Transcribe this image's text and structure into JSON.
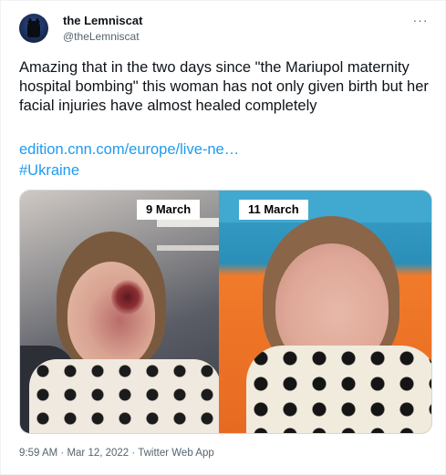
{
  "author": {
    "display_name": "the Lemniscat",
    "handle": "@theLemniscat"
  },
  "more_menu": "···",
  "tweet": {
    "text": "Amazing that in the two days since \"the Mariupol maternity hospital bombing\" this woman has not only given birth but her facial injuries have almost healed completely",
    "link": "edition.cnn.com/europe/live-ne…",
    "hashtag": "#Ukraine"
  },
  "media": {
    "left_label": "9 March",
    "right_label": "11 March"
  },
  "meta": {
    "time": "9:59 AM",
    "separator1": " · ",
    "date": "Mar 12, 2022",
    "separator2": " · ",
    "source": "Twitter Web App"
  },
  "colors": {
    "link": "#1d9bf0",
    "secondary_text": "#536471",
    "primary_text": "#0f1419"
  }
}
